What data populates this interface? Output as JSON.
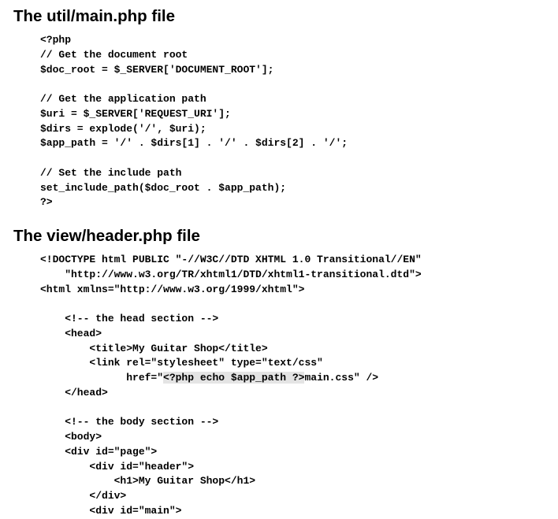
{
  "sections": [
    {
      "heading": "The util/main.php file",
      "lines": [
        "<?php",
        "// Get the document root",
        "$doc_root = $_SERVER['DOCUMENT_ROOT'];",
        "",
        "// Get the application path",
        "$uri = $_SERVER['REQUEST_URI'];",
        "$dirs = explode('/', $uri);",
        "$app_path = '/' . $dirs[1] . '/' . $dirs[2] . '/';",
        "",
        "// Set the include path",
        "set_include_path($doc_root . $app_path);",
        "?>"
      ]
    },
    {
      "heading": "The view/header.php file",
      "lines": [
        "<!DOCTYPE html PUBLIC \"-//W3C//DTD XHTML 1.0 Transitional//EN\"",
        "    \"http://www.w3.org/TR/xhtml1/DTD/xhtml1-transitional.dtd\">",
        "<html xmlns=\"http://www.w3.org/1999/xhtml\">",
        "",
        "    <!-- the head section -->",
        "    <head>",
        "        <title>My Guitar Shop</title>",
        "        <link rel=\"stylesheet\" type=\"text/css\"",
        "              href=\"",
        "    </head>",
        "",
        "    <!-- the body section -->",
        "    <body>",
        "    <div id=\"page\">",
        "        <div id=\"header\">",
        "            <h1>My Guitar Shop</h1>",
        "        </div>",
        "        <div id=\"main\">"
      ],
      "highlight_line": {
        "embedded_php": "<?php echo $app_path ?>",
        "suffix": "main.css\" />"
      }
    }
  ]
}
